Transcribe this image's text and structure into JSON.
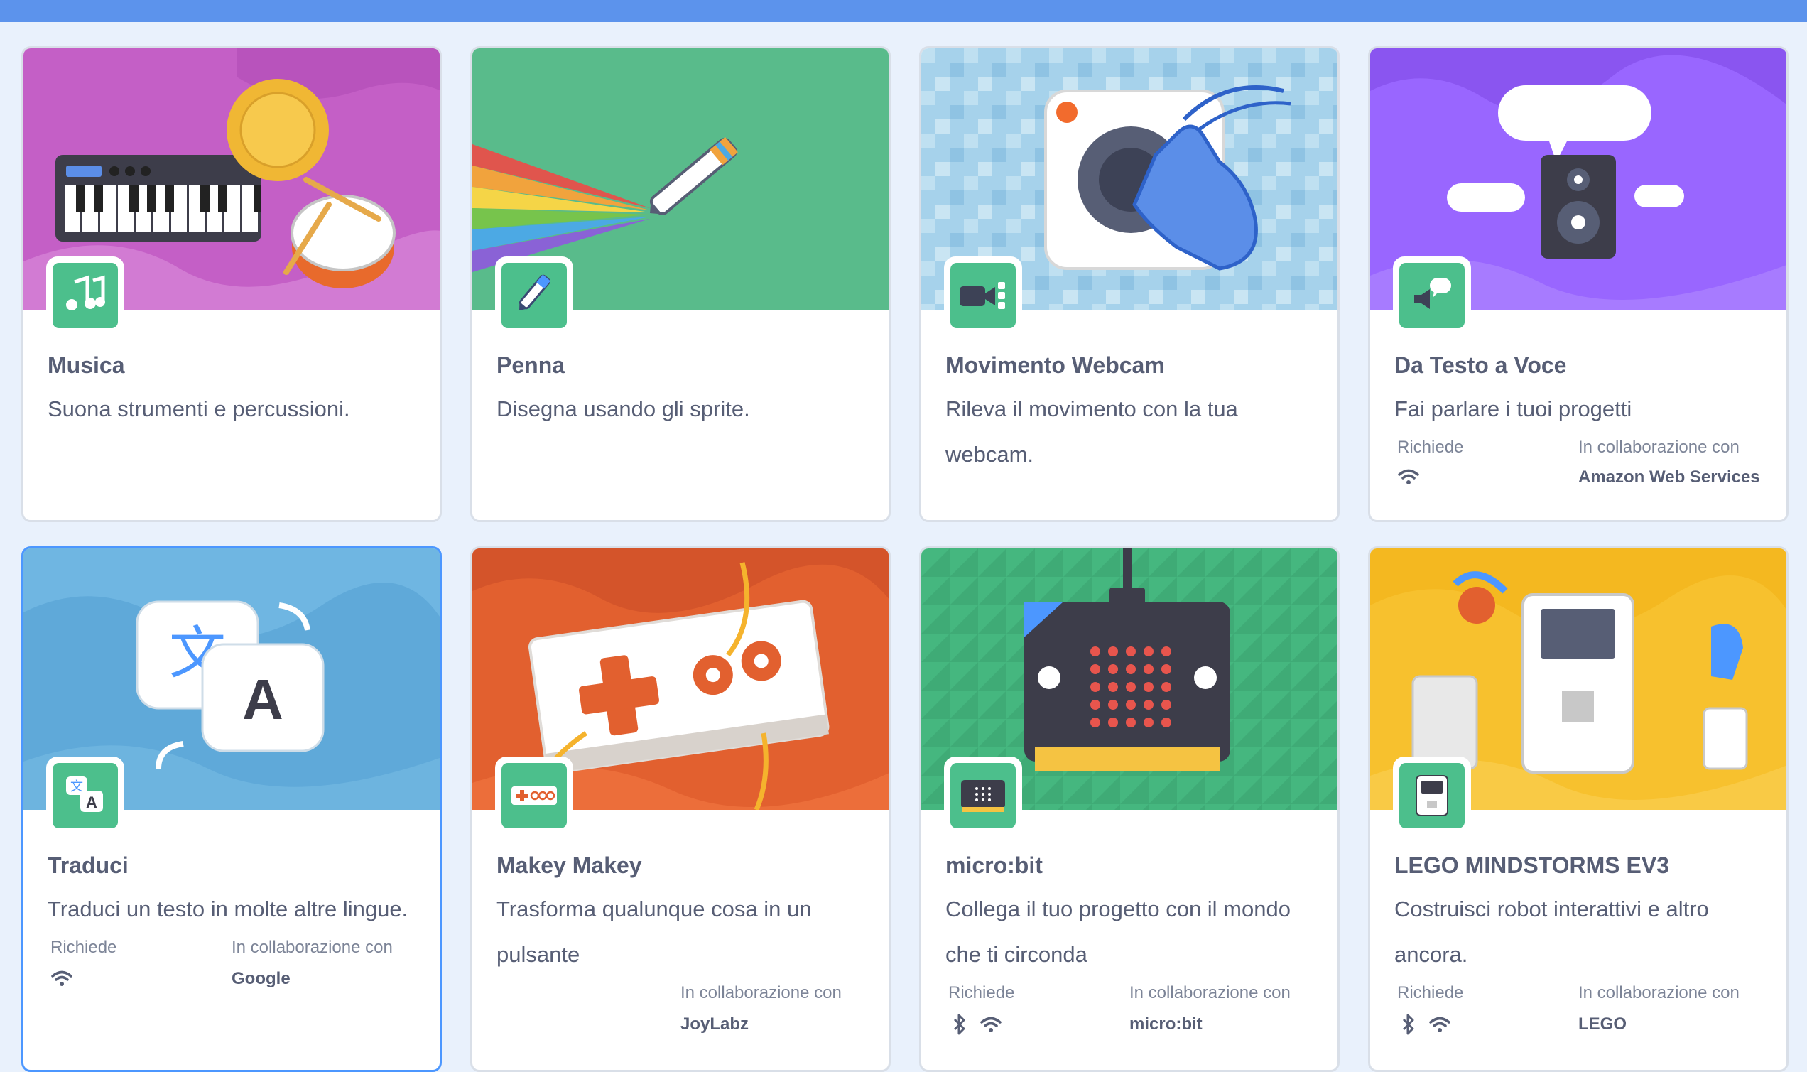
{
  "labels": {
    "requires": "Richiede",
    "collaboration": "In collaborazione con"
  },
  "extensions": [
    {
      "id": "music",
      "title": "Musica",
      "description": "Suona strumenti e percussioni.",
      "requires": [],
      "collaborator": "",
      "icon": "music-notes-icon",
      "art_color": "#c45fc6"
    },
    {
      "id": "pen",
      "title": "Penna",
      "description": "Disegna usando gli sprite.",
      "requires": [],
      "collaborator": "",
      "icon": "pen-icon",
      "art_color": "#59bb8b"
    },
    {
      "id": "video",
      "title": "Movimento Webcam",
      "description": "Rileva il movimento con la tua webcam.",
      "requires": [],
      "collaborator": "",
      "icon": "video-camera-icon",
      "art_color": "#a8d4ea"
    },
    {
      "id": "tts",
      "title": "Da Testo a Voce",
      "description": "Fai parlare i tuoi progetti",
      "requires": [
        "wifi"
      ],
      "collaborator": "Amazon Web Services",
      "icon": "speech-icon",
      "art_color": "#9966ff"
    },
    {
      "id": "translate",
      "title": "Traduci",
      "description": "Traduci un testo in molte altre lingue.",
      "requires": [
        "wifi"
      ],
      "collaborator": "Google",
      "icon": "translate-icon",
      "art_color": "#5fa9d9"
    },
    {
      "id": "makey",
      "title": "Makey Makey",
      "description": "Trasforma qualunque cosa in un pulsante",
      "requires": [],
      "collaborator": "JoyLabz",
      "icon": "makey-makey-icon",
      "art_color": "#e2602f"
    },
    {
      "id": "microbit",
      "title": "micro:bit",
      "description": "Collega il tuo progetto con il mondo che ti circonda",
      "requires": [
        "bluetooth",
        "wifi"
      ],
      "collaborator": "micro:bit",
      "icon": "microbit-icon",
      "art_color": "#45b77f"
    },
    {
      "id": "ev3",
      "title": "LEGO MINDSTORMS EV3",
      "description": "Costruisci robot interattivi e altro ancora.",
      "requires": [
        "bluetooth",
        "wifi"
      ],
      "collaborator": "LEGO",
      "icon": "ev3-brick-icon",
      "art_color": "#f7c12e"
    }
  ],
  "colors": {
    "accent": "#4cbf8c",
    "selected_border": "#4c97ff",
    "top_bar": "#5c93ec"
  }
}
